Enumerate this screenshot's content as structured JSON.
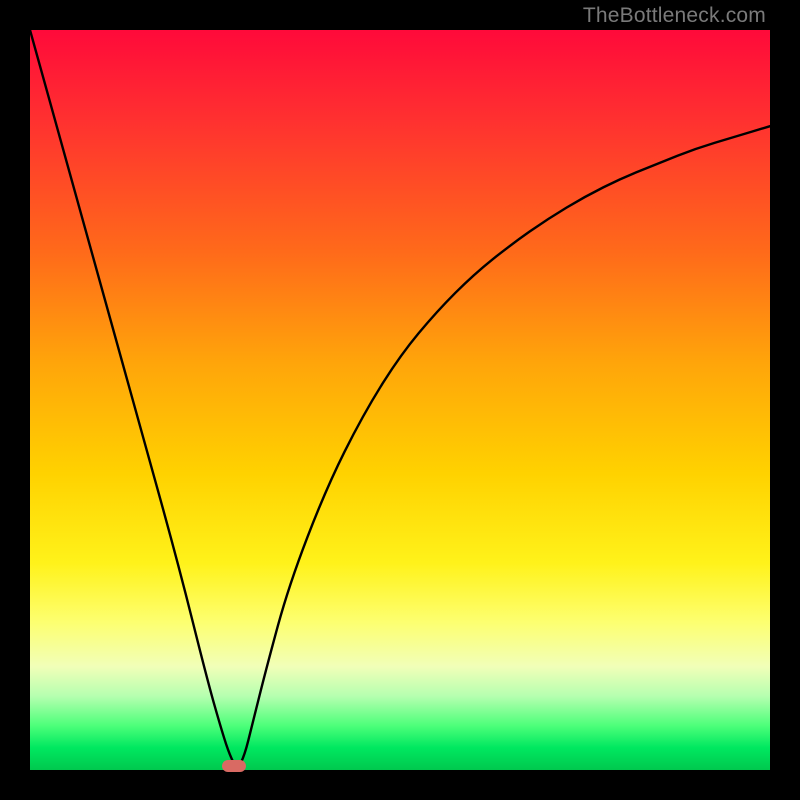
{
  "watermark": "TheBottleneck.com",
  "chart_data": {
    "type": "line",
    "title": "",
    "xlabel": "",
    "ylabel": "",
    "xlim": [
      0,
      100
    ],
    "ylim": [
      0,
      100
    ],
    "grid": false,
    "legend": false,
    "series": [
      {
        "name": "bottleneck-curve",
        "x": [
          0,
          5,
          10,
          15,
          20,
          24,
          26,
          27,
          28,
          29,
          30,
          32,
          35,
          40,
          45,
          50,
          55,
          60,
          65,
          70,
          75,
          80,
          85,
          90,
          95,
          100
        ],
        "values": [
          100,
          82,
          64,
          46,
          28,
          12,
          5,
          2,
          0,
          2,
          6,
          14,
          25,
          38,
          48,
          56,
          62,
          67,
          71,
          74.5,
          77.5,
          80,
          82,
          84,
          85.5,
          87
        ]
      }
    ],
    "marker": {
      "x": 27.5,
      "y": 0.5
    },
    "gradient_stops": [
      {
        "pos": 0,
        "color": "#ff0a3a"
      },
      {
        "pos": 60,
        "color": "#ffd200"
      },
      {
        "pos": 86,
        "color": "#f1ffb8"
      },
      {
        "pos": 100,
        "color": "#00c84e"
      }
    ]
  }
}
